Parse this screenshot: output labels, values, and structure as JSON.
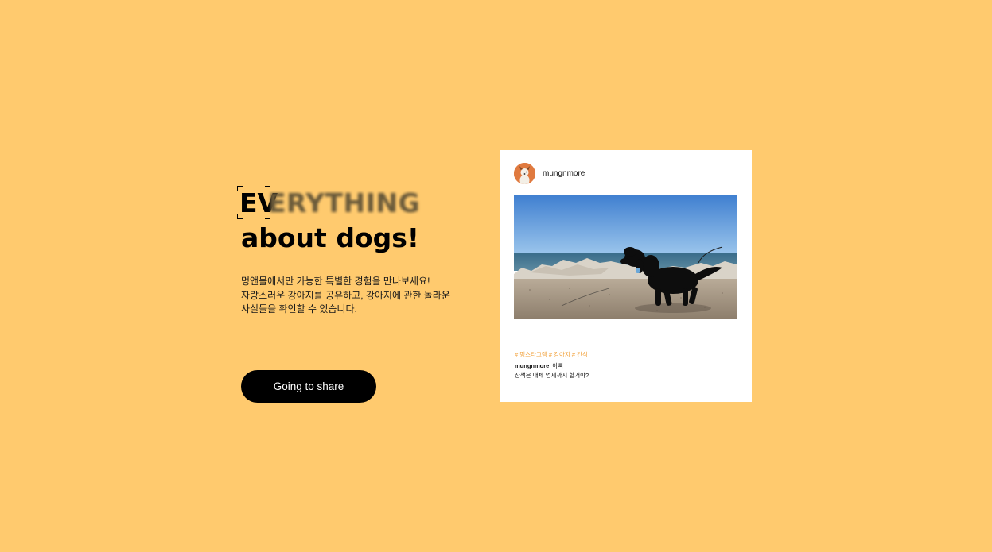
{
  "hero": {
    "focus_text": "EV",
    "blur_text": "ERYTHING",
    "headline_line2": "about dogs!",
    "description": [
      "멍앤몰에서만 가능한 특별한 경험을 만나보세요!",
      "자랑스러운 강아지를 공유하고, 강아지에 관한 놀라운",
      "사실들을 확인할 수 있습니다."
    ],
    "cta_label": "Going to share"
  },
  "post": {
    "username": "mungnmore",
    "tags": "# 멍스타그램 # 강아지 # 간식",
    "caption_user": "mungnmore",
    "caption_text": "아빠",
    "caption_line2": "산책은 대체 언제까지 할거야?"
  },
  "colors": {
    "background": "#FFCA6E",
    "cta_bg": "#000000",
    "tag_color": "#F2A23C",
    "avatar_bg": "#E07A3F"
  },
  "icons": {
    "avatar": "dog-avatar-icon",
    "photo": "black-dog-walking-photo"
  }
}
